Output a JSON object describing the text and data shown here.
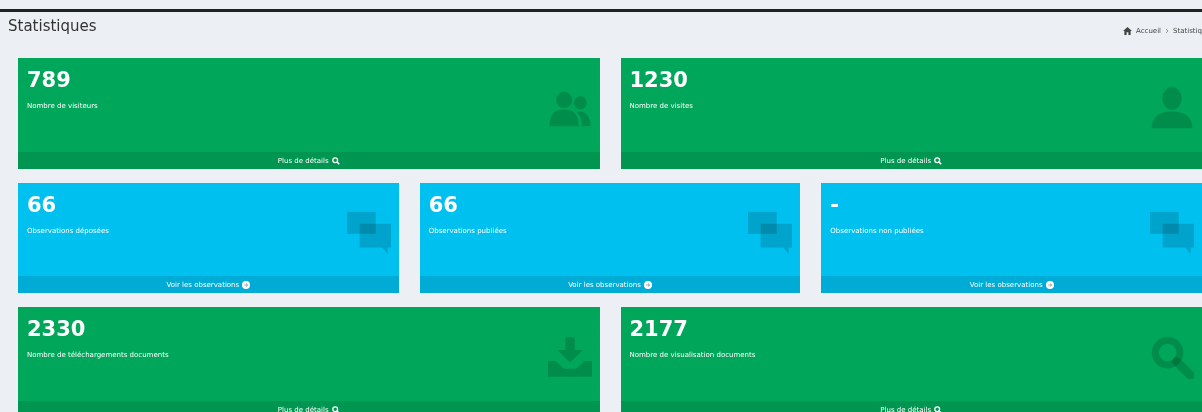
{
  "page_title": "Statistiques",
  "breadcrumb": [
    {
      "label": "Accueil"
    },
    {
      "label": "Statistiq"
    }
  ],
  "rows": [
    {
      "cards": [
        {
          "value": "789",
          "label": "Nombre de visiteurs",
          "color": "#00a65a",
          "link": "Plus de détails"
        },
        {
          "value": "1230",
          "label": "Nombre de visites",
          "color": "#00a65a",
          "link": "Plus de détails"
        }
      ]
    },
    {
      "cards": [
        {
          "value": "66",
          "label": "Observations déposées",
          "color": "#00c0ef",
          "link": "Voir les observations"
        },
        {
          "value": "66",
          "label": "Observations publiées",
          "color": "#00c0ef",
          "link": "Voir les observations"
        },
        {
          "value": "-",
          "label": "Observations non publiées",
          "color": "#00c0ef",
          "link": "Voir les observations"
        }
      ]
    },
    {
      "cards": [
        {
          "value": "2330",
          "label": "Nombre de téléchargements documents",
          "color": "#00a65a",
          "link": "Plus de détails"
        },
        {
          "value": "2177",
          "label": "Nombre de visualisation documents",
          "color": "#00a65a",
          "link": "Plus de détails"
        }
      ]
    }
  ]
}
